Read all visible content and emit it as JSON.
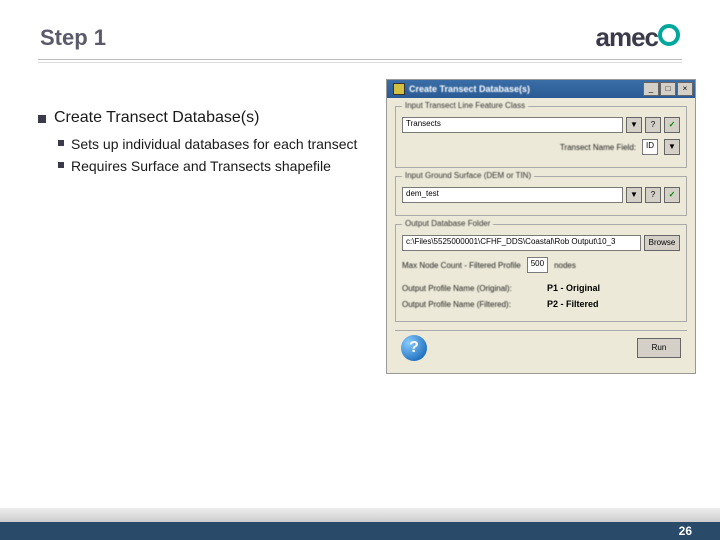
{
  "header": {
    "title": "Step 1",
    "logo_text": "amec"
  },
  "bullets": {
    "main": "Create Transect Database(s)",
    "sub": [
      "Sets up individual databases for each transect",
      "Requires Surface and Transects shapefile"
    ]
  },
  "dialog": {
    "title": "Create Transect Database(s)",
    "win_min": "_",
    "win_max": "□",
    "win_close": "×",
    "group1": {
      "label": "Input Transect Line Feature Class",
      "value": "Transects",
      "dropdown": "▼",
      "help": "?",
      "check": "✓"
    },
    "namefield": {
      "label": "Transect Name Field:",
      "value": "ID",
      "dropdown": "▼"
    },
    "group2": {
      "label": "Input Ground Surface (DEM or TIN)",
      "value": "dem_test",
      "dropdown": "▼",
      "help": "?",
      "check": "✓"
    },
    "group3": {
      "label": "Output Database Folder",
      "path": "c:\\Files\\5525000001\\CFHF_DDS\\Coastal\\Rob Output\\10_3",
      "browse": "Browse",
      "maxnode_label": "Max Node Count - Filtered Profile",
      "maxnode_val": "500",
      "maxnode_suffix": "nodes",
      "orig_label": "Output Profile Name (Original):",
      "orig_val": "P1 - Original",
      "filt_label": "Output Profile Name (Filtered):",
      "filt_val": "P2 - Filtered"
    },
    "run": "Run"
  },
  "footer": {
    "page": "26"
  }
}
